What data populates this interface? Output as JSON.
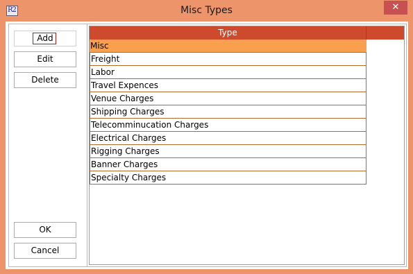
{
  "window": {
    "title": "Misc Types",
    "app_icon_text": "R2",
    "close_label": "✕"
  },
  "buttons": {
    "add": "Add",
    "edit": "Edit",
    "delete": "Delete",
    "ok": "OK",
    "cancel": "Cancel"
  },
  "table": {
    "column_header": "Type",
    "rows": [
      "Misc",
      "Freight",
      "Labor",
      "Travel Expences",
      "Venue Charges",
      "Shipping Charges",
      "Telecomminucation Charges",
      "Electrical Charges",
      "Rigging Charges",
      "Banner Charges",
      "Specialty Charges"
    ],
    "selected_index": 0
  },
  "colors": {
    "frame": "#ed946a",
    "header": "#cd4b2c",
    "selected_row": "#f9a04e",
    "close_button": "#c75050"
  }
}
